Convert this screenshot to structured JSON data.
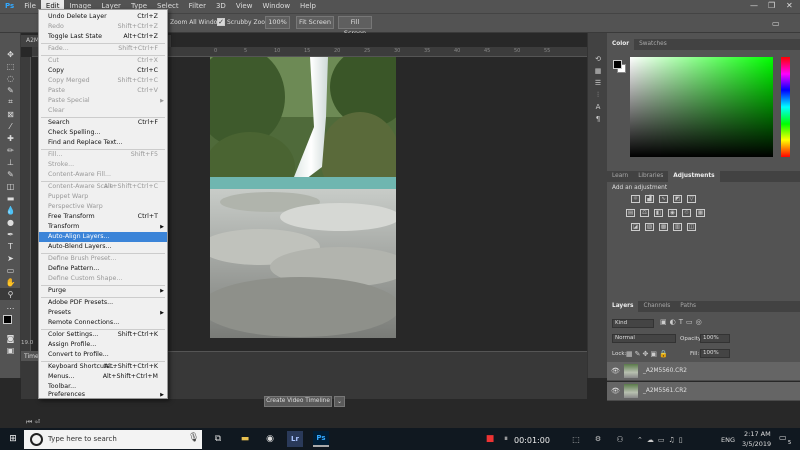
{
  "menubar": {
    "items": [
      "File",
      "Edit",
      "Image",
      "Layer",
      "Type",
      "Select",
      "Filter",
      "3D",
      "View",
      "Window",
      "Help"
    ]
  },
  "options": {
    "scroll_all": "Zoom All Windows",
    "scrubby": "Scrubby Zoom",
    "zoom_btn": "100%",
    "fit_btn": "Fit Screen",
    "fill_btn": "Fill Screen"
  },
  "document": {
    "tab": "A2M...",
    "status": "19.0"
  },
  "ruler": {
    "ticks": [
      "0",
      "5",
      "10",
      "15",
      "20",
      "25",
      "30",
      "35",
      "40",
      "45",
      "50",
      "55"
    ]
  },
  "edit_menu": {
    "items": [
      {
        "label": "Undo Delete Layer",
        "shortcut": "Ctrl+Z",
        "disabled": false
      },
      {
        "label": "Redo",
        "shortcut": "Shift+Ctrl+Z",
        "disabled": true
      },
      {
        "label": "Toggle Last State",
        "shortcut": "Alt+Ctrl+Z",
        "disabled": false
      },
      {
        "label": "Fade...",
        "shortcut": "Shift+Ctrl+F",
        "disabled": true
      },
      {
        "label": "Cut",
        "shortcut": "Ctrl+X",
        "disabled": true
      },
      {
        "label": "Copy",
        "shortcut": "Ctrl+C",
        "disabled": false
      },
      {
        "label": "Copy Merged",
        "shortcut": "Shift+Ctrl+C",
        "disabled": true
      },
      {
        "label": "Paste",
        "shortcut": "Ctrl+V",
        "disabled": true
      },
      {
        "label": "Paste Special",
        "shortcut": "",
        "disabled": true
      },
      {
        "label": "Clear",
        "shortcut": "",
        "disabled": true
      },
      {
        "label": "Search",
        "shortcut": "Ctrl+F",
        "disabled": false
      },
      {
        "label": "Check Spelling...",
        "shortcut": "",
        "disabled": false
      },
      {
        "label": "Find and Replace Text...",
        "shortcut": "",
        "disabled": false
      },
      {
        "label": "Fill...",
        "shortcut": "Shift+F5",
        "disabled": true
      },
      {
        "label": "Stroke...",
        "shortcut": "",
        "disabled": true
      },
      {
        "label": "Content-Aware Fill...",
        "shortcut": "",
        "disabled": true
      },
      {
        "label": "Content-Aware Scale",
        "shortcut": "Alt+Shift+Ctrl+C",
        "disabled": true
      },
      {
        "label": "Puppet Warp",
        "shortcut": "",
        "disabled": true
      },
      {
        "label": "Perspective Warp",
        "shortcut": "",
        "disabled": true
      },
      {
        "label": "Free Transform",
        "shortcut": "Ctrl+T",
        "disabled": false
      },
      {
        "label": "Transform",
        "shortcut": "",
        "disabled": false
      },
      {
        "label": "Auto-Align Layers...",
        "shortcut": "",
        "disabled": false
      },
      {
        "label": "Auto-Blend Layers...",
        "shortcut": "",
        "disabled": false
      },
      {
        "label": "Define Brush Preset...",
        "shortcut": "",
        "disabled": true
      },
      {
        "label": "Define Pattern...",
        "shortcut": "",
        "disabled": false
      },
      {
        "label": "Define Custom Shape...",
        "shortcut": "",
        "disabled": true
      },
      {
        "label": "Purge",
        "shortcut": "",
        "disabled": false
      },
      {
        "label": "Adobe PDF Presets...",
        "shortcut": "",
        "disabled": false
      },
      {
        "label": "Presets",
        "shortcut": "",
        "disabled": false
      },
      {
        "label": "Remote Connections...",
        "shortcut": "",
        "disabled": false
      },
      {
        "label": "Color Settings...",
        "shortcut": "Shift+Ctrl+K",
        "disabled": false
      },
      {
        "label": "Assign Profile...",
        "shortcut": "",
        "disabled": false
      },
      {
        "label": "Convert to Profile...",
        "shortcut": "",
        "disabled": false
      },
      {
        "label": "Keyboard Shortcuts...",
        "shortcut": "Alt+Shift+Ctrl+K",
        "disabled": false
      },
      {
        "label": "Menus...",
        "shortcut": "Alt+Shift+Ctrl+M",
        "disabled": false
      },
      {
        "label": "Toolbar...",
        "shortcut": "",
        "disabled": false
      },
      {
        "label": "Preferences",
        "shortcut": "",
        "disabled": false
      }
    ],
    "highlighted": "Auto-Align Layers..."
  },
  "color_panel": {
    "tabs": [
      "Color",
      "Swatches"
    ],
    "active": "Color"
  },
  "adjust_panel": {
    "tabs": [
      "Learn",
      "Libraries",
      "Adjustments"
    ],
    "active": "Adjustments",
    "hint": "Add an adjustment"
  },
  "layers_panel": {
    "tabs": [
      "Layers",
      "Channels",
      "Paths"
    ],
    "kind": "Kind",
    "blend": "Normal",
    "opacity_label": "Opacity:",
    "opacity": "100%",
    "lock_label": "Lock:",
    "fill_label": "Fill:",
    "fill": "100%",
    "layers": [
      "_A2M5560.CR2",
      "_A2M5561.CR2"
    ]
  },
  "timeline": {
    "tab": "Time",
    "button": "Create Video Timeline"
  },
  "taskbar": {
    "search_placeholder": "Type here to search",
    "record_time": "00:01:00",
    "lang": "ENG",
    "time": "2:17 AM",
    "date": "3/5/2019",
    "notif": "5"
  }
}
